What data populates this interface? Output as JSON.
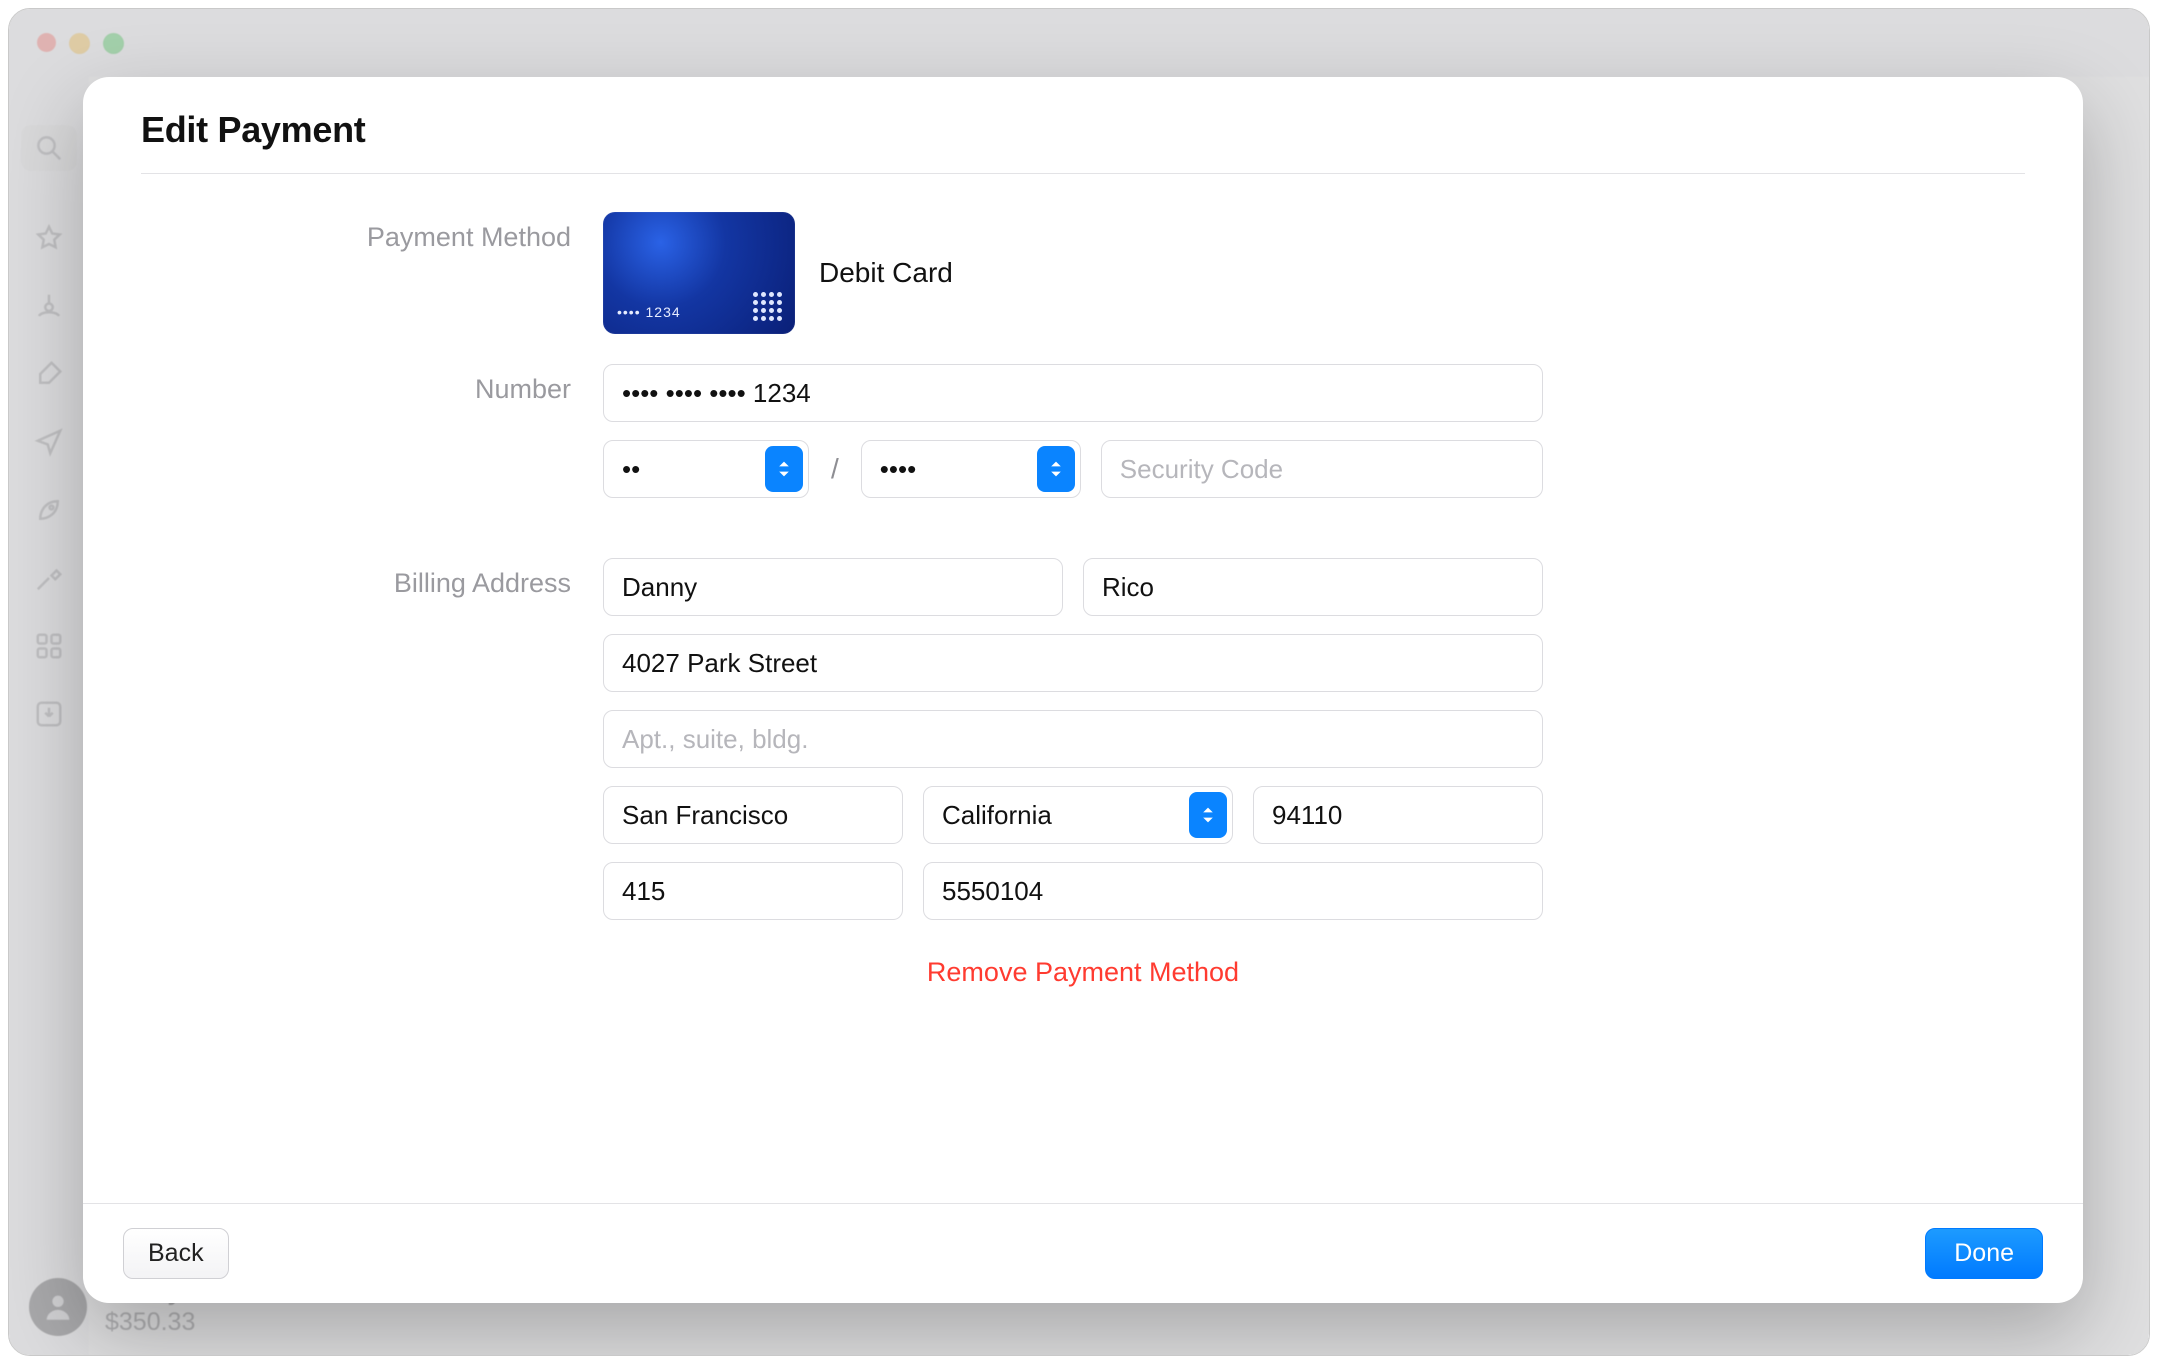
{
  "window": {
    "traffic_lights": [
      "close",
      "minimize",
      "zoom"
    ]
  },
  "sidebar": {
    "search_placeholder": "",
    "items": [
      "discover",
      "arcade",
      "create",
      "work",
      "play",
      "develop",
      "categories",
      "updates"
    ]
  },
  "user_footer": {
    "name": "Danny Rico",
    "balance": "$350.33"
  },
  "sheet": {
    "title": "Edit Payment",
    "sections": {
      "payment_method": {
        "label": "Payment Method",
        "card_type": "Debit Card",
        "card_masked_short": "•••• 1234"
      },
      "number": {
        "label": "Number",
        "value": "•••• •••• •••• 1234",
        "exp_month_display": "••",
        "exp_year_display": "••••",
        "security_placeholder": "Security Code"
      },
      "billing": {
        "label": "Billing Address",
        "first_name": "Danny",
        "last_name": "Rico",
        "street1": "4027 Park Street",
        "street2_placeholder": "Apt., suite, bldg.",
        "city": "San Francisco",
        "state": "California",
        "postal": "94110",
        "phone_area": "415",
        "phone_number": "5550104"
      }
    },
    "remove_label": "Remove Payment Method",
    "footer": {
      "back": "Back",
      "done": "Done"
    }
  }
}
